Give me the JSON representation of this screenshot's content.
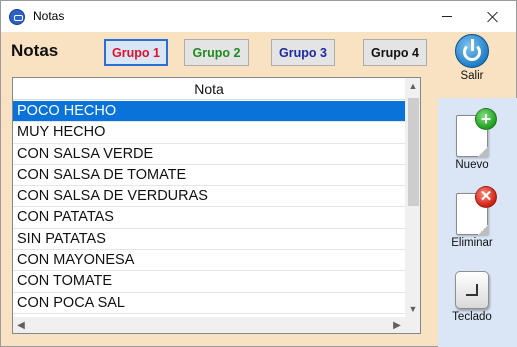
{
  "window": {
    "title": "Notas"
  },
  "header": {
    "title": "Notas"
  },
  "groups": [
    {
      "label": "Grupo 1",
      "color": "#e0102a",
      "selected": true
    },
    {
      "label": "Grupo 2",
      "color": "#1f8b1f",
      "selected": false
    },
    {
      "label": "Grupo 3",
      "color": "#1e2a9e",
      "selected": false
    },
    {
      "label": "Grupo 4",
      "color": "#111111",
      "selected": false
    }
  ],
  "actions": {
    "salir": {
      "label": "Salir",
      "icon": "power-icon"
    },
    "nuevo": {
      "label": "Nuevo",
      "icon": "new-document-icon"
    },
    "eliminar": {
      "label": "Eliminar",
      "icon": "delete-document-icon"
    },
    "teclado": {
      "label": "Teclado",
      "icon": "keyboard-enter-icon"
    }
  },
  "list": {
    "column_header": "Nota",
    "selected_index": 0,
    "items": [
      "POCO HECHO",
      "MUY HECHO",
      "CON SALSA VERDE",
      "CON SALSA DE TOMATE",
      "CON SALSA DE VERDURAS",
      "CON PATATAS",
      "SIN PATATAS",
      "CON MAYONESA",
      "CON TOMATE",
      "CON POCA SAL"
    ]
  },
  "colors": {
    "header_bg": "#f9e2c1",
    "side_bg": "#dae6f5",
    "selection": "#0a73d9"
  }
}
